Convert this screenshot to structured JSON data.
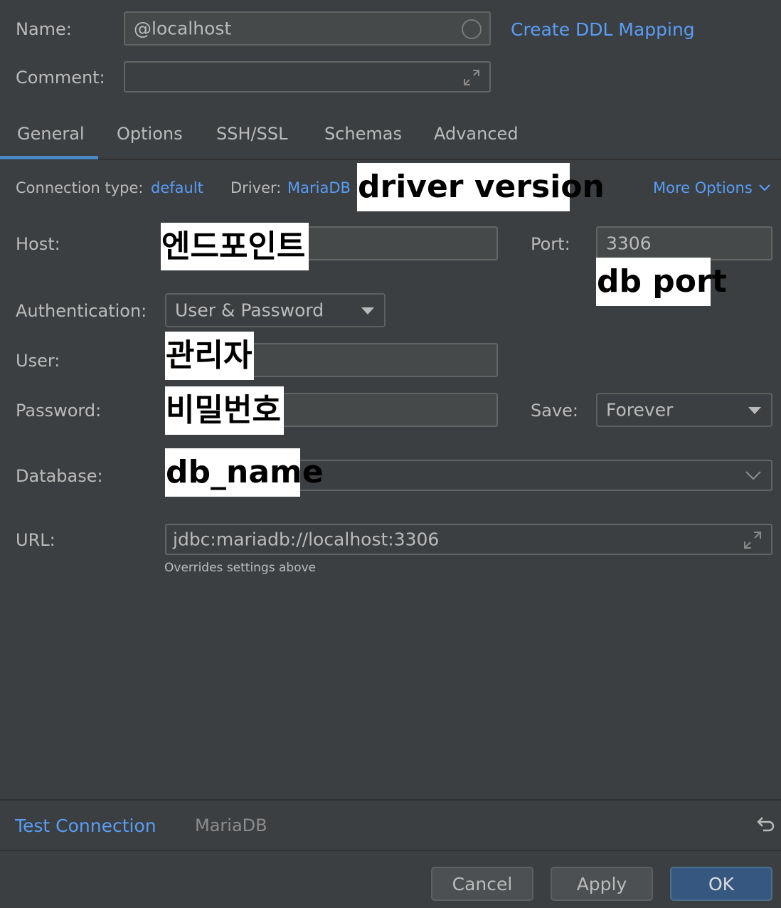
{
  "header": {
    "name_label": "Name:",
    "name_value": "@localhost",
    "create_ddl_link": "Create DDL Mapping",
    "comment_label": "Comment:",
    "comment_value": ""
  },
  "tabs": [
    {
      "label": "General",
      "active": true
    },
    {
      "label": "Options"
    },
    {
      "label": "SSH/SSL"
    },
    {
      "label": "Schemas"
    },
    {
      "label": "Advanced"
    }
  ],
  "general": {
    "connection_type_label": "Connection type:",
    "connection_type_value": "default",
    "driver_label": "Driver:",
    "driver_value": "MariaDB",
    "driver_version_annotation": "driver version",
    "more_options": "More Options",
    "host_label": "Host:",
    "host_annotation": "엔드포인트",
    "port_label": "Port:",
    "port_value": "3306",
    "port_annotation": "db port",
    "auth_label": "Authentication:",
    "auth_value": "User & Password",
    "user_label": "User:",
    "user_annotation": "관리자",
    "password_label": "Password:",
    "password_annotation": "비밀번호",
    "save_label": "Save:",
    "save_value": "Forever",
    "database_label": "Database:",
    "database_annotation": "db_name",
    "url_label": "URL:",
    "url_value": "jdbc:mariadb://localhost:3306",
    "url_hint": "Overrides settings above"
  },
  "footer": {
    "test_connection": "Test Connection",
    "driver_name": "MariaDB",
    "cancel": "Cancel",
    "apply": "Apply",
    "ok": "OK"
  },
  "colors": {
    "background": "#3c3f41",
    "link": "#589df6",
    "tab_underline": "#4a88c7",
    "ok_button": "#365880"
  },
  "icons": {
    "name_circle": "circle-icon",
    "expand": "expand-icon",
    "chevron": "chevron-down-icon",
    "revert": "revert-icon"
  }
}
